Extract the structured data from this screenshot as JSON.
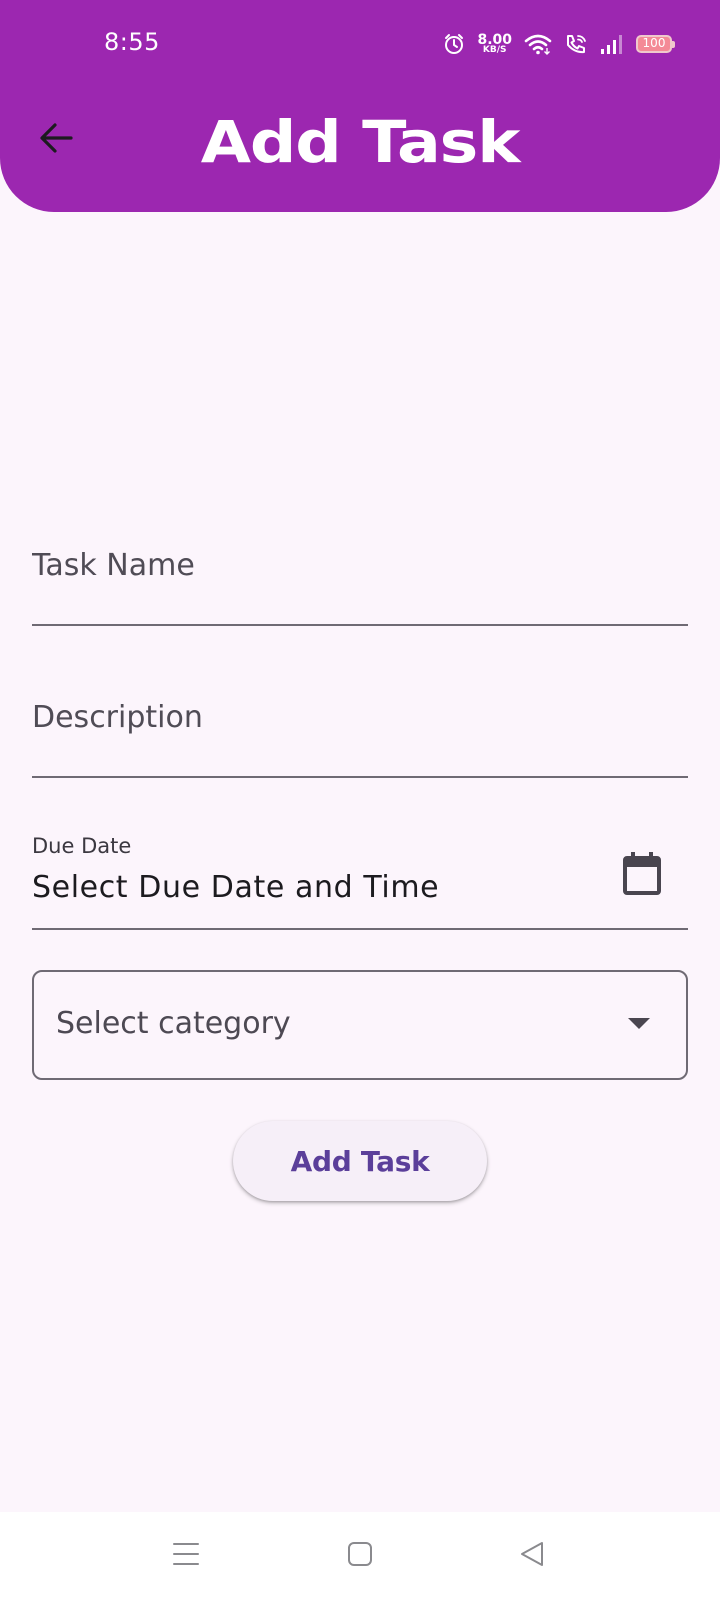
{
  "status_bar": {
    "time": "8:55",
    "network_speed_value": "8.00",
    "network_speed_unit": "KB/S",
    "battery_level": "100"
  },
  "header": {
    "title": "Add Task",
    "back_icon": "arrow-back-icon",
    "background_color": "#9c27b0"
  },
  "form": {
    "task_name_placeholder": "Task Name",
    "description_placeholder": "Description",
    "due_date_label": "Due Date",
    "due_date_value": "Select Due Date and Time",
    "due_date_icon": "calendar-icon",
    "category_placeholder": "Select category",
    "category_icon": "dropdown-arrow-icon",
    "submit_label": "Add Task"
  },
  "nav_bar": {
    "icons": [
      "menu-icon",
      "home-square-icon",
      "back-triangle-icon"
    ]
  }
}
